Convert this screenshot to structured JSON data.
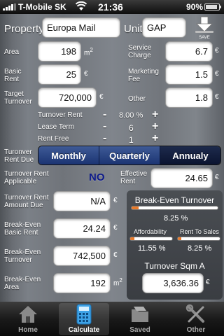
{
  "status_bar": {
    "carrier": "T-Mobile SK",
    "time": "21:36",
    "battery": "90%",
    "battery_level": 0.9
  },
  "header": {
    "property_label": "Property",
    "property_value": "Europa Mail",
    "unit_label": "Unit",
    "unit_value": "GAP",
    "save_label": "SAVE"
  },
  "fields": {
    "area": {
      "label": "Area",
      "value": "198",
      "unit": "m",
      "sup": "2"
    },
    "basic_rent": {
      "label": "Basic\nRent",
      "value": "25",
      "unit": "€"
    },
    "target_turnover": {
      "label": "Target\nTurnover",
      "value": "720,000",
      "unit": "€"
    },
    "service_charge": {
      "label": "Service\nCharge",
      "value": "6.7",
      "unit": "€"
    },
    "marketing_fee": {
      "label": "Marketing\nFee",
      "value": "1.5",
      "unit": "€"
    },
    "other": {
      "label": "Other",
      "value": "1.8",
      "unit": "€"
    }
  },
  "steppers": {
    "turnover_rent": {
      "label": "Turnover Rent",
      "minus": "-",
      "value": "8.00 %",
      "plus": "+"
    },
    "lease_term": {
      "label": "Lease Term",
      "minus": "-",
      "value": "6",
      "plus": "+"
    },
    "rent_free": {
      "label": "Rent Free",
      "minus": "-",
      "value": "1",
      "plus": "+"
    }
  },
  "turnover_rent_due": {
    "label": "Turonver\nRent Due",
    "options": [
      "Monthly",
      "Quarterly",
      "Annualy"
    ],
    "selected": "Annualy"
  },
  "results": {
    "applicable": {
      "label": "Turnover Rent\nApplicable",
      "value": "NO"
    },
    "effective_rent": {
      "label": "Effective\nRent",
      "value": "24.65",
      "unit": "€"
    },
    "amount_due": {
      "label": "Turnover Rent\nAmount Due",
      "value": "N/A",
      "unit": "€"
    },
    "be_basic_rent": {
      "label": "Break-Even\nBasic Rent",
      "value": "24.24",
      "unit": "€"
    },
    "be_turnover": {
      "label": "Break-Even\nTurnover",
      "value": "742,500",
      "unit": "€"
    },
    "be_area": {
      "label": "Break-Even\nArea",
      "value": "192",
      "unit": "m",
      "sup": "2"
    }
  },
  "break_even_panel": {
    "title": "Break-Even Turnover",
    "turnover_pct": "8.25 %",
    "turnover_level": 0.08,
    "affordability_label": "Affordability",
    "affordability_pct": "11.55 %",
    "affordability_level": 0.1,
    "rent_to_sales_label": "Rent To Sales",
    "rent_to_sales_pct": "8.25 %",
    "rent_to_sales_level": 0.08,
    "sqm_title": "Turnover Sqm A",
    "sqm_value": "3,636.36",
    "sqm_unit": "€"
  },
  "tabs": [
    {
      "label": "Home",
      "icon": "home-icon"
    },
    {
      "label": "Calculate",
      "icon": "calculator-icon",
      "selected": true
    },
    {
      "label": "Saved",
      "icon": "folder-icon"
    },
    {
      "label": "Other",
      "icon": "tools-icon"
    }
  ],
  "colors": {
    "accent_orange": "#e87a2a",
    "segment_blue": "#1b3472",
    "no_text": "#0d1a8a"
  }
}
